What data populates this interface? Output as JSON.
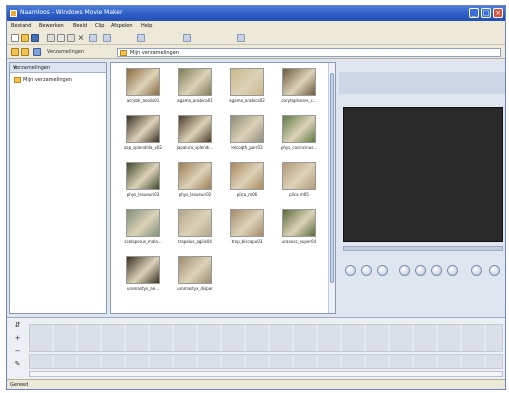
{
  "window": {
    "title": "Naamloos - Windows Movie Maker"
  },
  "menu": [
    {
      "label": "Bestand"
    },
    {
      "label": "Bewerken"
    },
    {
      "label": "Beeld"
    },
    {
      "label": "Clip"
    },
    {
      "label": "Afspelen"
    },
    {
      "label": "Help"
    }
  ],
  "toolbar": {
    "collections_label": "Verzamelingen",
    "collection_value": "Mijn verzamelingen"
  },
  "left_pane": {
    "header": "Verzamelingen",
    "close": "×",
    "tree": [
      {
        "label": "Mijn verzamelingen"
      }
    ]
  },
  "clips": [
    {
      "name": "acrybh_anolis01",
      "color": "#8a6b3c"
    },
    {
      "name": "agama_arabica01",
      "color": "#7f7b55"
    },
    {
      "name": "agama_arabica02",
      "color": "#c9b88a"
    },
    {
      "name": "corytophanes_c...",
      "color": "#6b5a3e"
    },
    {
      "name": "zap_splendida_x02",
      "color": "#3a3226"
    },
    {
      "name": "japalura_splendi...",
      "color": "#4d3d2a"
    },
    {
      "name": "lelcoqth_parr03",
      "color": "#8c8b7a"
    },
    {
      "name": "phys_cocincinus...",
      "color": "#5f7a45"
    },
    {
      "name": "phys_lesueuri03",
      "color": "#3d4a2c"
    },
    {
      "name": "phys_lesueuri02",
      "color": "#9a7d55"
    },
    {
      "name": "plica_m06",
      "color": "#a8875c"
    },
    {
      "name": "plica m05",
      "color": "#b49a78"
    },
    {
      "name": "sceloporus_mala...",
      "color": "#7d8f77"
    },
    {
      "name": "trapelus_agilis04",
      "color": "#b1a48a"
    },
    {
      "name": "trop_biscapu03",
      "color": "#a58a6a"
    },
    {
      "name": "uranosc_super04",
      "color": "#5a6a3a"
    },
    {
      "name": "uromastyx_ae...",
      "color": "#3b3020"
    },
    {
      "name": "uromastyx_dispar",
      "color": "#9d8c6e"
    }
  ],
  "colors": {
    "titlebar": "#2a5bc4",
    "preview_screen": "#2a2a2a"
  },
  "status": {
    "text": "Gereed"
  }
}
